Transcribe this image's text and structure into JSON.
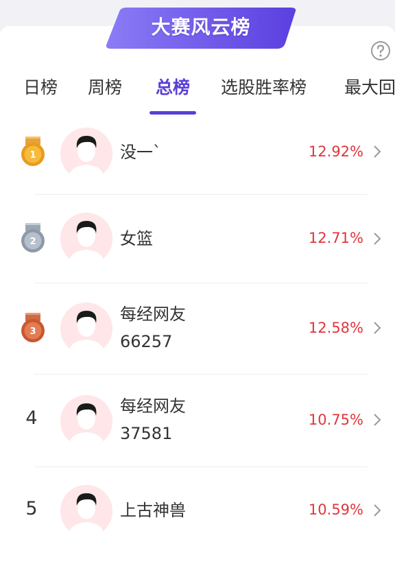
{
  "banner": {
    "title": "大赛风云榜"
  },
  "help": {
    "icon": "question-circle-icon"
  },
  "tabs": [
    {
      "label": "日榜"
    },
    {
      "label": "周榜"
    },
    {
      "label": "总榜",
      "active": true
    },
    {
      "label": "选股胜率榜"
    },
    {
      "label": "最大回"
    }
  ],
  "colors": {
    "accent": "#5a3fd6",
    "rate": "#e0353b",
    "gold": "#f5a623",
    "silver": "#a9b3bf",
    "bronze": "#d96a42"
  },
  "leaderboard": [
    {
      "rank": "1",
      "medal": "gold-medal-icon",
      "name_line1": "没一`",
      "name_line2": "",
      "rate": "12.92%"
    },
    {
      "rank": "2",
      "medal": "silver-medal-icon",
      "name_line1": "女篮",
      "name_line2": "",
      "rate": "12.71%"
    },
    {
      "rank": "3",
      "medal": "bronze-medal-icon",
      "name_line1": "每经网友",
      "name_line2": "66257",
      "rate": "12.58%"
    },
    {
      "rank": "4",
      "medal": "",
      "name_line1": "每经网友",
      "name_line2": "37581",
      "rate": "10.75%"
    },
    {
      "rank": "5",
      "medal": "",
      "name_line1": "上古神兽",
      "name_line2": "",
      "rate": "10.59%"
    }
  ]
}
